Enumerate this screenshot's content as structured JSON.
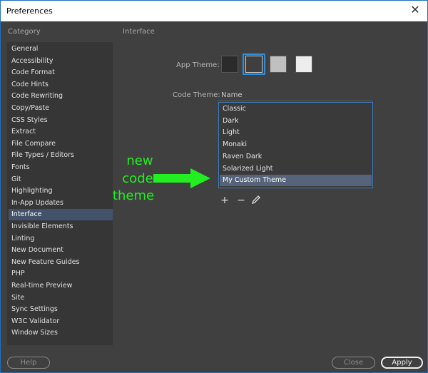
{
  "window": {
    "title": "Preferences"
  },
  "sidebar": {
    "heading": "Category",
    "items": [
      {
        "label": "General"
      },
      {
        "label": "Accessibility"
      },
      {
        "label": "Code Format"
      },
      {
        "label": "Code Hints"
      },
      {
        "label": "Code Rewriting"
      },
      {
        "label": "Copy/Paste"
      },
      {
        "label": "CSS Styles"
      },
      {
        "label": "Extract"
      },
      {
        "label": "File Compare"
      },
      {
        "label": "File Types / Editors"
      },
      {
        "label": "Fonts"
      },
      {
        "label": "Git"
      },
      {
        "label": "Highlighting"
      },
      {
        "label": "In-App Updates"
      },
      {
        "label": "Interface"
      },
      {
        "label": "Invisible Elements"
      },
      {
        "label": "Linting"
      },
      {
        "label": "New Document"
      },
      {
        "label": "New Feature Guides"
      },
      {
        "label": "PHP"
      },
      {
        "label": "Real-time Preview"
      },
      {
        "label": "Site"
      },
      {
        "label": "Sync Settings"
      },
      {
        "label": "W3C Validator"
      },
      {
        "label": "Window Sizes"
      }
    ],
    "selected": "Interface"
  },
  "panel": {
    "heading": "Interface",
    "app_theme_label": "App Theme:",
    "app_theme_swatches": [
      "#2b2b2b",
      "#3f3f3f",
      "#c0c0c0",
      "#ededed"
    ],
    "app_theme_selected": 1,
    "code_theme_label": "Code Theme:",
    "name_column": "Name",
    "code_themes": [
      {
        "label": "Classic"
      },
      {
        "label": "Dark"
      },
      {
        "label": "Light"
      },
      {
        "label": "Monaki"
      },
      {
        "label": "Raven Dark"
      },
      {
        "label": "Solarized Light"
      },
      {
        "label": "My Custom Theme"
      }
    ],
    "code_theme_selected": "My Custom Theme",
    "tools": {
      "add": "+",
      "remove": "−",
      "edit_icon": "pencil-icon"
    }
  },
  "annotation": {
    "lines": [
      "new",
      "code",
      "theme"
    ],
    "color": "#22ee22"
  },
  "buttons": {
    "help": "Help",
    "close": "Close",
    "apply": "Apply"
  },
  "accent": "#2e8fdc"
}
